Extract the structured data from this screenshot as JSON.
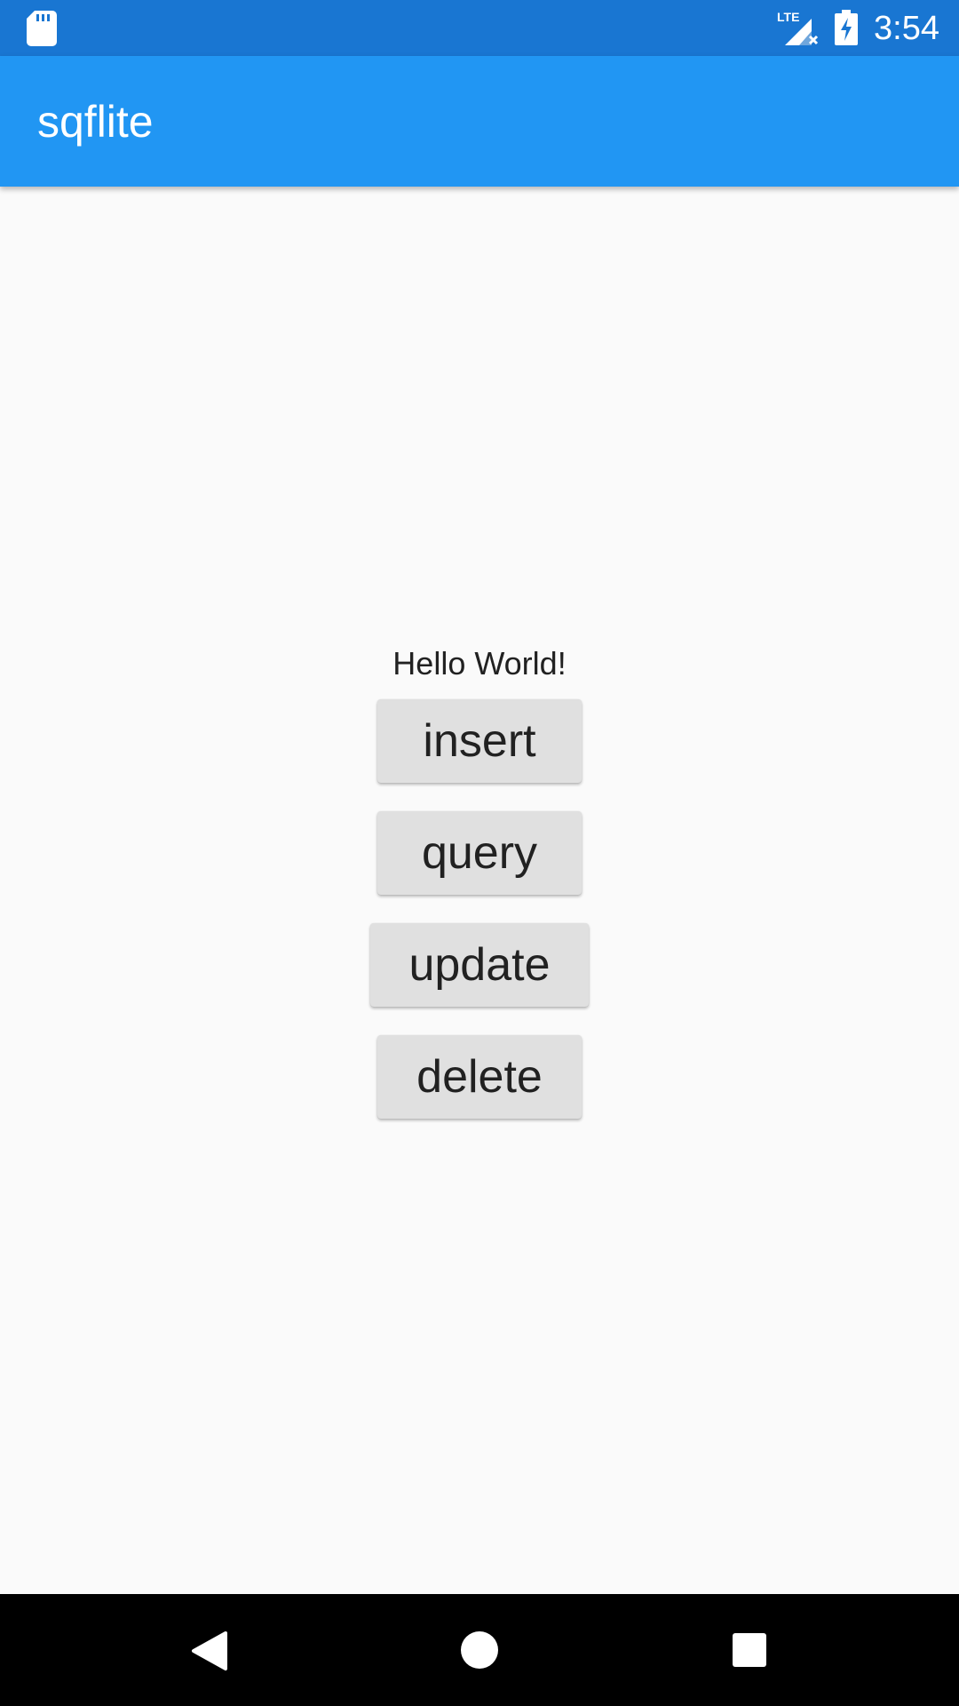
{
  "status_bar": {
    "time": "3:54",
    "network_label": "LTE",
    "icons": [
      "sd-card-icon",
      "lte-signal-icon",
      "battery-charging-icon"
    ]
  },
  "app_bar": {
    "title": "sqflite",
    "color": "#2196f3",
    "status_color": "#1976d2"
  },
  "content": {
    "message": "Hello World!",
    "buttons": {
      "insert": "insert",
      "query": "query",
      "update": "update",
      "delete": "delete"
    }
  },
  "nav_bar": {
    "icons": [
      "back-icon",
      "home-icon",
      "recents-icon"
    ]
  }
}
